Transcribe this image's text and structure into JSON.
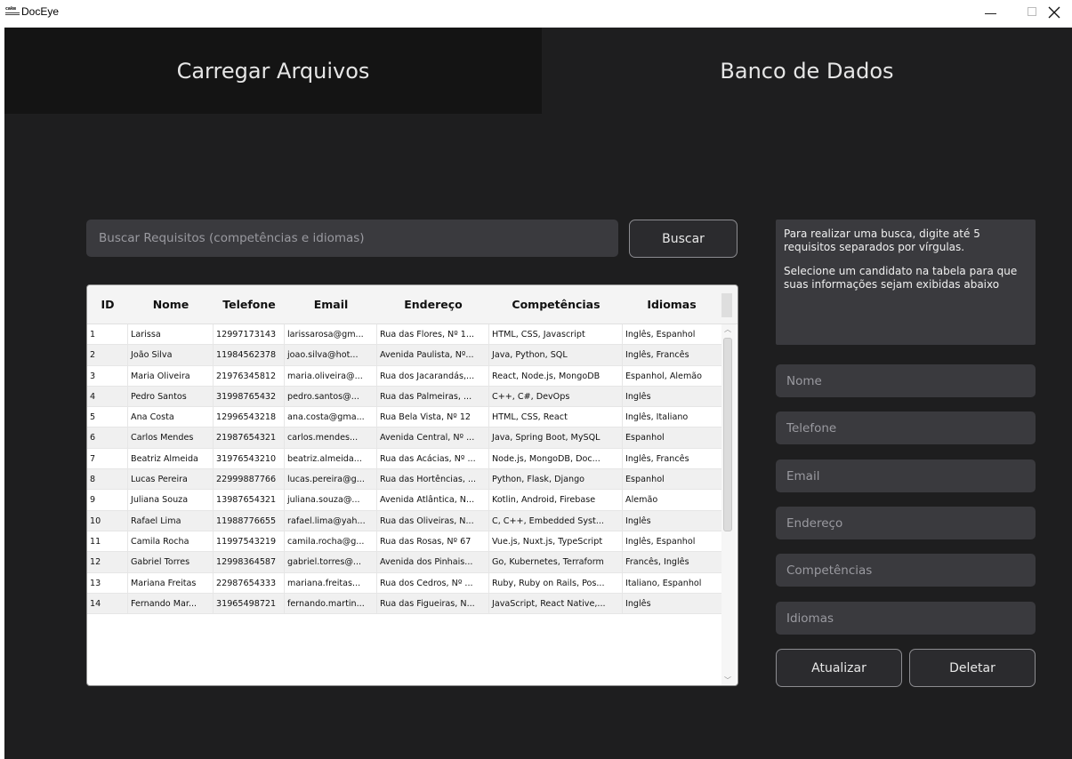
{
  "window": {
    "title": "DocEye",
    "logo_text": "cake"
  },
  "tabs": {
    "upload": "Carregar Arquivos",
    "database": "Banco de Dados"
  },
  "search": {
    "placeholder": "Buscar Requisitos (competências e idiomas)",
    "button": "Buscar"
  },
  "table": {
    "columns": [
      "ID",
      "Nome",
      "Telefone",
      "Email",
      "Endereço",
      "Competências",
      "Idiomas"
    ],
    "rows": [
      [
        "1",
        "Larissa",
        "12997173143",
        "larissarosa@gm...",
        "Rua das Flores, Nº 1...",
        "HTML, CSS, Javascript",
        "Inglês, Espanhol"
      ],
      [
        "2",
        "João Silva",
        "11984562378",
        "joao.silva@hot...",
        "Avenida Paulista, Nº...",
        "Java, Python, SQL",
        "Inglês, Francês"
      ],
      [
        "3",
        "Maria Oliveira",
        "21976345812",
        "maria.oliveira@...",
        "Rua dos Jacarandás,...",
        "React, Node.js, MongoDB",
        "Espanhol, Alemão"
      ],
      [
        "4",
        "Pedro Santos",
        "31998765432",
        "pedro.santos@...",
        "Rua das Palmeiras, ...",
        "C++, C#, DevOps",
        "Inglês"
      ],
      [
        "5",
        "Ana Costa",
        "12996543218",
        "ana.costa@gma...",
        "Rua Bela Vista, Nº 12",
        "HTML, CSS, React",
        "Inglês, Italiano"
      ],
      [
        "6",
        "Carlos Mendes",
        "21987654321",
        "carlos.mendes...",
        "Avenida Central, Nº ...",
        "Java, Spring Boot, MySQL",
        "Espanhol"
      ],
      [
        "7",
        "Beatriz Almeida",
        "31976543210",
        "beatriz.almeida...",
        "Rua das Acácias, Nº ...",
        "Node.js, MongoDB, Doc...",
        "Inglês, Francês"
      ],
      [
        "8",
        "Lucas Pereira",
        "22999887766",
        "lucas.pereira@g...",
        "Rua das Hortências, ...",
        "Python, Flask, Django",
        "Espanhol"
      ],
      [
        "9",
        "Juliana Souza",
        "13987654321",
        "juliana.souza@...",
        "Avenida Atlântica, N...",
        "Kotlin, Android, Firebase",
        "Alemão"
      ],
      [
        "10",
        "Rafael Lima",
        "11988776655",
        "rafael.lima@yah...",
        "Rua das Oliveiras, N...",
        "C, C++, Embedded Syst...",
        "Inglês"
      ],
      [
        "11",
        "Camila Rocha",
        "11997543219",
        "camila.rocha@g...",
        "Rua das Rosas, Nº 67",
        "Vue.js, Nuxt.js, TypeScript",
        "Inglês, Espanhol"
      ],
      [
        "12",
        "Gabriel Torres",
        "12998364587",
        "gabriel.torres@...",
        "Avenida dos Pinhais...",
        "Go, Kubernetes, Terraform",
        "Francês, Inglês"
      ],
      [
        "13",
        "Mariana Freitas",
        "22987654333",
        "mariana.freitas...",
        "Rua dos Cedros, Nº ...",
        "Ruby, Ruby on Rails, Pos...",
        "Italiano, Espanhol"
      ],
      [
        "14",
        "Fernando Mar...",
        "31965498721",
        "fernando.martin...",
        "Rua das Figueiras, N...",
        "JavaScript, React Native,...",
        "Inglês"
      ]
    ]
  },
  "info": {
    "line1": "Para realizar uma busca, digite até 5 requisitos separados por vírgulas.",
    "line2": "Selecione um candidato na tabela para que suas informações sejam exibidas abaixo"
  },
  "form": {
    "nome_placeholder": "Nome",
    "telefone_placeholder": "Telefone",
    "email_placeholder": "Email",
    "endereco_placeholder": "Endereço",
    "competencias_placeholder": "Competências",
    "idiomas_placeholder": "Idiomas"
  },
  "actions": {
    "update": "Atualizar",
    "delete": "Deletar"
  }
}
